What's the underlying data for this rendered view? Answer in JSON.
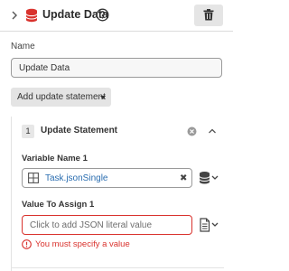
{
  "header": {
    "title": "Update Data",
    "icons": {
      "expand": "chevron-right-icon",
      "type": "database-icon",
      "help": "help-icon",
      "delete": "trash-icon"
    },
    "colors": {
      "type_icon": "#d9322d"
    }
  },
  "name_field": {
    "label": "Name",
    "value": "Update Data"
  },
  "add_button": {
    "label": "Add update statement"
  },
  "statement": {
    "number": "1",
    "title": "Update Statement",
    "variable": {
      "label": "Variable Name 1",
      "value": "Task.jsonSingle",
      "icon": "table-icon"
    },
    "value": {
      "label": "Value To Assign 1",
      "placeholder": "Click to add JSON literal value",
      "error": "You must specify a value"
    }
  },
  "colors": {
    "error": "#d9322d",
    "link": "#2a6db0"
  }
}
